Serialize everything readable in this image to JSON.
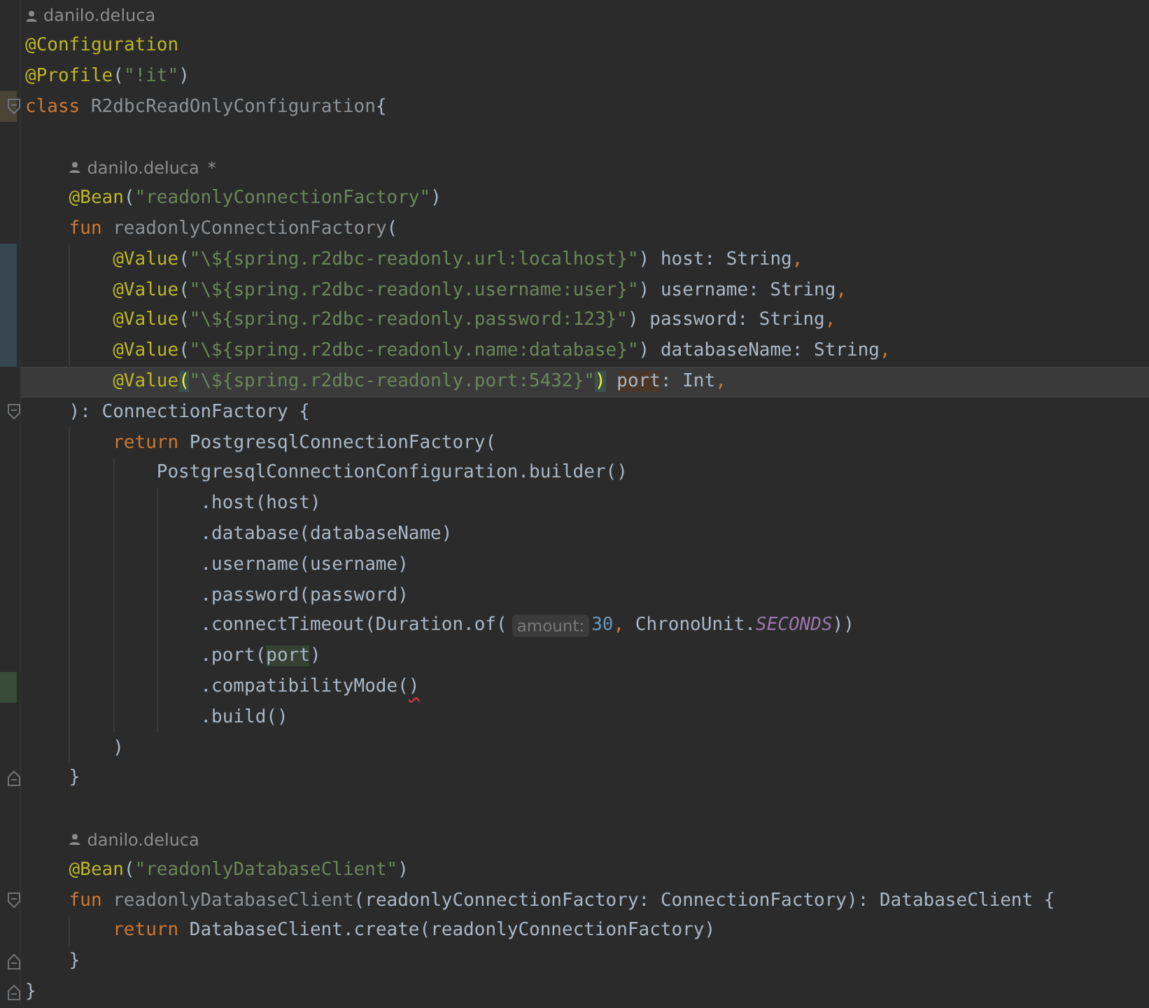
{
  "lines": [
    {
      "kind": "author",
      "name": "danilo.deluca"
    },
    {
      "kind": "code",
      "tokens": [
        {
          "kind": "annotation",
          "text": "@Configuration"
        }
      ]
    },
    {
      "kind": "code",
      "tokens": [
        {
          "kind": "annotation",
          "text": "@Profile"
        },
        {
          "kind": "plain",
          "text": "("
        },
        {
          "kind": "string",
          "text": "\"!it\""
        },
        {
          "kind": "plain",
          "text": ")"
        }
      ]
    },
    {
      "kind": "code",
      "fold_start": true,
      "highlighted": true,
      "tokens": [
        {
          "kind": "keyword",
          "text": "class "
        },
        {
          "kind": "declaration",
          "text": "R2dbcReadOnlyConfiguration"
        },
        {
          "kind": "plain",
          "text": "{"
        }
      ],
      "children": [
        {
          "kind": "blank"
        },
        {
          "kind": "author",
          "name": "danilo.deluca",
          "suffix": "*"
        },
        {
          "kind": "code",
          "tokens": [
            {
              "kind": "annotation",
              "text": "@Bean"
            },
            {
              "kind": "plain",
              "text": "("
            },
            {
              "kind": "string",
              "text": "\"readonlyConnectionFactory\""
            },
            {
              "kind": "plain",
              "text": ")"
            }
          ]
        },
        {
          "kind": "code",
          "tokens": [
            {
              "kind": "keyword",
              "text": "fun "
            },
            {
              "kind": "declaration",
              "text": "readonlyConnectionFactory"
            },
            {
              "kind": "plain",
              "text": "("
            }
          ],
          "children": [
            {
              "kind": "code",
              "modified": true,
              "tokens": [
                {
                  "kind": "annotation",
                  "text": "@Value"
                },
                {
                  "kind": "plain",
                  "text": "("
                },
                {
                  "kind": "string",
                  "text": "\"\\${spring.r2dbc-readonly.url:localhost}\""
                },
                {
                  "kind": "plain",
                  "text": ") host: String"
                },
                {
                  "kind": "punct",
                  "text": ","
                }
              ]
            },
            {
              "kind": "code",
              "modified": true,
              "tokens": [
                {
                  "kind": "annotation",
                  "text": "@Value"
                },
                {
                  "kind": "plain",
                  "text": "("
                },
                {
                  "kind": "string",
                  "text": "\"\\${spring.r2dbc-readonly.username:user}\""
                },
                {
                  "kind": "plain",
                  "text": ") username: String"
                },
                {
                  "kind": "punct",
                  "text": ","
                }
              ]
            },
            {
              "kind": "code",
              "modified": true,
              "tokens": [
                {
                  "kind": "annotation",
                  "text": "@Value"
                },
                {
                  "kind": "plain",
                  "text": "("
                },
                {
                  "kind": "string",
                  "text": "\"\\${spring.r2dbc-readonly.password:123}\""
                },
                {
                  "kind": "plain",
                  "text": ") password: String"
                },
                {
                  "kind": "punct",
                  "text": ","
                }
              ]
            },
            {
              "kind": "code",
              "modified": true,
              "tokens": [
                {
                  "kind": "annotation",
                  "text": "@Value"
                },
                {
                  "kind": "plain",
                  "text": "("
                },
                {
                  "kind": "string",
                  "text": "\"\\${spring.r2dbc-readonly.name:database}\""
                },
                {
                  "kind": "plain",
                  "text": ") databaseName: String"
                },
                {
                  "kind": "punct",
                  "text": ","
                }
              ]
            },
            {
              "kind": "code",
              "current": true,
              "tokens": [
                {
                  "kind": "annotation",
                  "text": "@Value"
                },
                {
                  "kind": "plain",
                  "text": "(",
                  "bracket_match": true
                },
                {
                  "kind": "string",
                  "text": "\"\\${spring.r2dbc-readonly.port:5432}\""
                },
                {
                  "kind": "plain",
                  "text": ")",
                  "bracket_match": true
                },
                {
                  "kind": "plain",
                  "text": "port",
                  "write_usage": true
                },
                {
                  "kind": "plain",
                  "text": ": Int"
                },
                {
                  "kind": "punct",
                  "text": ","
                }
              ]
            }
          ]
        },
        {
          "kind": "code",
          "fold_start": true,
          "tokens": [
            {
              "kind": "plain",
              "text": "): ConnectionFactory {"
            }
          ],
          "children": [
            {
              "kind": "code",
              "tokens": [
                {
                  "kind": "keyword",
                  "text": "return "
                },
                {
                  "kind": "plain",
                  "text": "PostgresqlConnectionFactory("
                }
              ],
              "children": [
                {
                  "kind": "code",
                  "tokens": [
                    {
                      "kind": "plain",
                      "text": "PostgresqlConnectionConfiguration.builder()"
                    }
                  ],
                  "children": [
                    {
                      "kind": "code",
                      "tokens": [
                        {
                          "kind": "plain",
                          "text": ".host(host)"
                        }
                      ]
                    },
                    {
                      "kind": "code",
                      "tokens": [
                        {
                          "kind": "plain",
                          "text": ".database(databaseName)"
                        }
                      ]
                    },
                    {
                      "kind": "code",
                      "tokens": [
                        {
                          "kind": "plain",
                          "text": ".username(username)"
                        }
                      ]
                    },
                    {
                      "kind": "code",
                      "tokens": [
                        {
                          "kind": "plain",
                          "text": ".password(password)"
                        }
                      ]
                    },
                    {
                      "kind": "code",
                      "tokens": [
                        {
                          "kind": "plain",
                          "text": ".connectTimeout(Duration.of("
                        },
                        {
                          "kind": "hint",
                          "text": "amount:"
                        },
                        {
                          "kind": "number",
                          "text": "30"
                        },
                        {
                          "kind": "punct",
                          "text": ","
                        },
                        {
                          "kind": "plain",
                          "text": " ChronoUnit."
                        },
                        {
                          "kind": "constant",
                          "text": "SECONDS"
                        },
                        {
                          "kind": "plain",
                          "text": "))"
                        }
                      ]
                    },
                    {
                      "kind": "code",
                      "tokens": [
                        {
                          "kind": "plain",
                          "text": ".port("
                        },
                        {
                          "kind": "plain",
                          "text": "port",
                          "read_usage": true
                        },
                        {
                          "kind": "plain",
                          "text": ")"
                        }
                      ]
                    },
                    {
                      "kind": "code",
                      "added": true,
                      "tokens": [
                        {
                          "kind": "plain",
                          "text": ".compatibilityMode("
                        },
                        {
                          "kind": "plain",
                          "text": ")",
                          "error": true
                        }
                      ]
                    },
                    {
                      "kind": "code",
                      "tokens": [
                        {
                          "kind": "plain",
                          "text": ".build()"
                        }
                      ]
                    }
                  ]
                }
              ]
            },
            {
              "kind": "code",
              "tokens": [
                {
                  "kind": "plain",
                  "text": ")"
                }
              ]
            }
          ]
        },
        {
          "kind": "code",
          "fold_end": true,
          "tokens": [
            {
              "kind": "plain",
              "text": "}"
            }
          ]
        },
        {
          "kind": "blank"
        },
        {
          "kind": "author",
          "name": "danilo.deluca"
        },
        {
          "kind": "code",
          "tokens": [
            {
              "kind": "annotation",
              "text": "@Bean"
            },
            {
              "kind": "plain",
              "text": "("
            },
            {
              "kind": "string",
              "text": "\"readonlyDatabaseClient\""
            },
            {
              "kind": "plain",
              "text": ")"
            }
          ]
        },
        {
          "kind": "code",
          "fold_start": true,
          "tokens": [
            {
              "kind": "keyword",
              "text": "fun "
            },
            {
              "kind": "declaration",
              "text": "readonlyDatabaseClient"
            },
            {
              "kind": "plain",
              "text": "(readonlyConnectionFactory: ConnectionFactory): DatabaseClient {"
            }
          ],
          "children": [
            {
              "kind": "code",
              "tokens": [
                {
                  "kind": "keyword",
                  "text": "return "
                },
                {
                  "kind": "plain",
                  "text": "DatabaseClient.create(readonlyConnectionFactory)"
                }
              ]
            }
          ]
        },
        {
          "kind": "code",
          "fold_end": true,
          "tokens": [
            {
              "kind": "plain",
              "text": "}"
            }
          ]
        }
      ]
    },
    {
      "kind": "code",
      "fold_end": true,
      "tokens": [
        {
          "kind": "plain",
          "text": "}"
        }
      ]
    }
  ]
}
